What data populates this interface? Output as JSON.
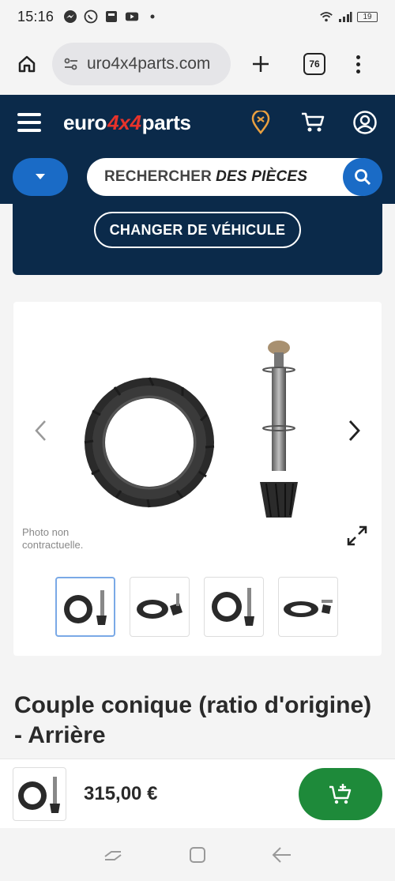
{
  "status_bar": {
    "time": "15:16",
    "battery": "19"
  },
  "browser": {
    "url": "uro4x4parts.com",
    "tab_count": "76"
  },
  "site": {
    "logo_left": "euro",
    "logo_mid": "4x4",
    "logo_right": "parts"
  },
  "search": {
    "placeholder_a": "RECHERCHER",
    "placeholder_b": "DES PIÈCES"
  },
  "vehicle": {
    "change_label": "CHANGER DE VÉHICULE"
  },
  "product": {
    "photo_note": "Photo non contractuelle.",
    "title": "Couple conique (ratio d'origine) - Arrière",
    "price": "315,00 €",
    "thumbnail_count": 4,
    "active_thumbnail": 1
  },
  "colors": {
    "header_bg": "#0b2a4a",
    "accent_blue": "#1a6bc6",
    "logo_red": "#e7332b",
    "cart_green": "#1e8a3a"
  },
  "icons": {
    "status_left": [
      "messenger-icon",
      "whatsapp-icon",
      "app-icon",
      "youtube-icon"
    ],
    "header": [
      "location-icon",
      "cart-icon",
      "account-icon"
    ]
  }
}
